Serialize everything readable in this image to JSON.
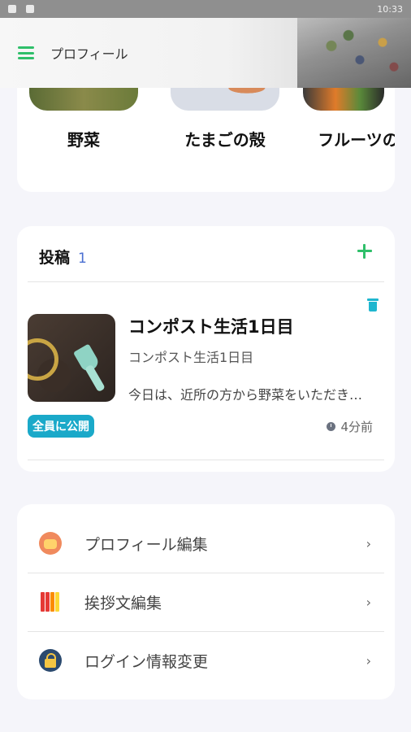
{
  "status_bar": {
    "time": "10:33"
  },
  "app_bar": {
    "title": "プロフィール"
  },
  "categories": [
    {
      "label": "野菜"
    },
    {
      "label": "たまごの殻"
    },
    {
      "label": "フルーツの"
    }
  ],
  "posts": {
    "title": "投稿",
    "count": "1",
    "items": [
      {
        "title": "コンポスト生活1日目",
        "subtitle": "コンポスト生活1日目",
        "excerpt": "今日は、近所の方から野菜をいただきました",
        "visibility": "全員に公開",
        "time": "4分前"
      }
    ]
  },
  "menu": [
    {
      "label": "プロフィール編集",
      "chevron": "›"
    },
    {
      "label": "挨拶文編集",
      "chevron": "›"
    },
    {
      "label": "ログイン情報変更",
      "chevron": "›"
    }
  ]
}
